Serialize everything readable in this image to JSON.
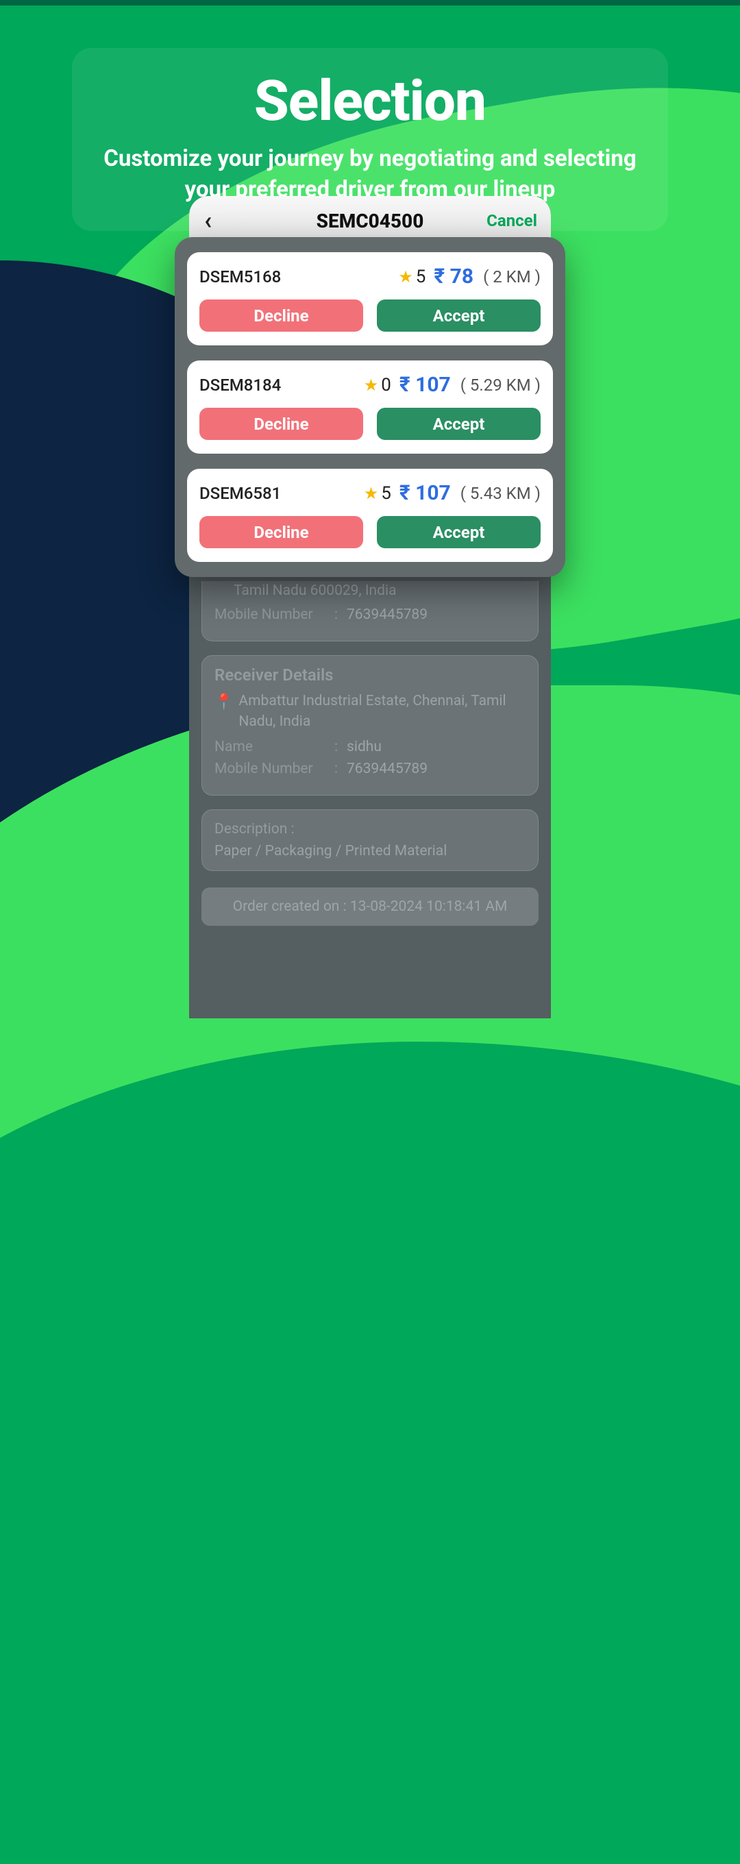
{
  "hero": {
    "title": "Selection",
    "subtitle": "Customize your journey by negotiating and selecting your preferred driver from our lineup"
  },
  "app": {
    "title": "SEMC04500",
    "cancel": "Cancel"
  },
  "drivers": [
    {
      "id": "DSEM5168",
      "rating": "5",
      "price": "₹ 78",
      "distance": "( 2 KM )"
    },
    {
      "id": "DSEM8184",
      "rating": "0",
      "price": "₹ 107",
      "distance": "( 5.29 KM )"
    },
    {
      "id": "DSEM6581",
      "rating": "5",
      "price": "₹ 107",
      "distance": "( 5.43 KM )"
    }
  ],
  "buttons": {
    "decline": "Decline",
    "accept": "Accept"
  },
  "sender": {
    "address_tail": "Tamil Nadu 600029, India",
    "mobile_label": "Mobile Number",
    "mobile": "7639445789"
  },
  "receiver": {
    "heading": "Receiver Details",
    "address": "Ambattur Industrial Estate, Chennai, Tamil Nadu, India",
    "name_label": "Name",
    "name": "sidhu",
    "mobile_label": "Mobile Number",
    "mobile": "7639445789"
  },
  "description": {
    "label": "Description :",
    "value": "Paper / Packaging / Printed Material"
  },
  "created": "Order created on : 13-08-2024 10:18:41 AM",
  "colon": ":"
}
